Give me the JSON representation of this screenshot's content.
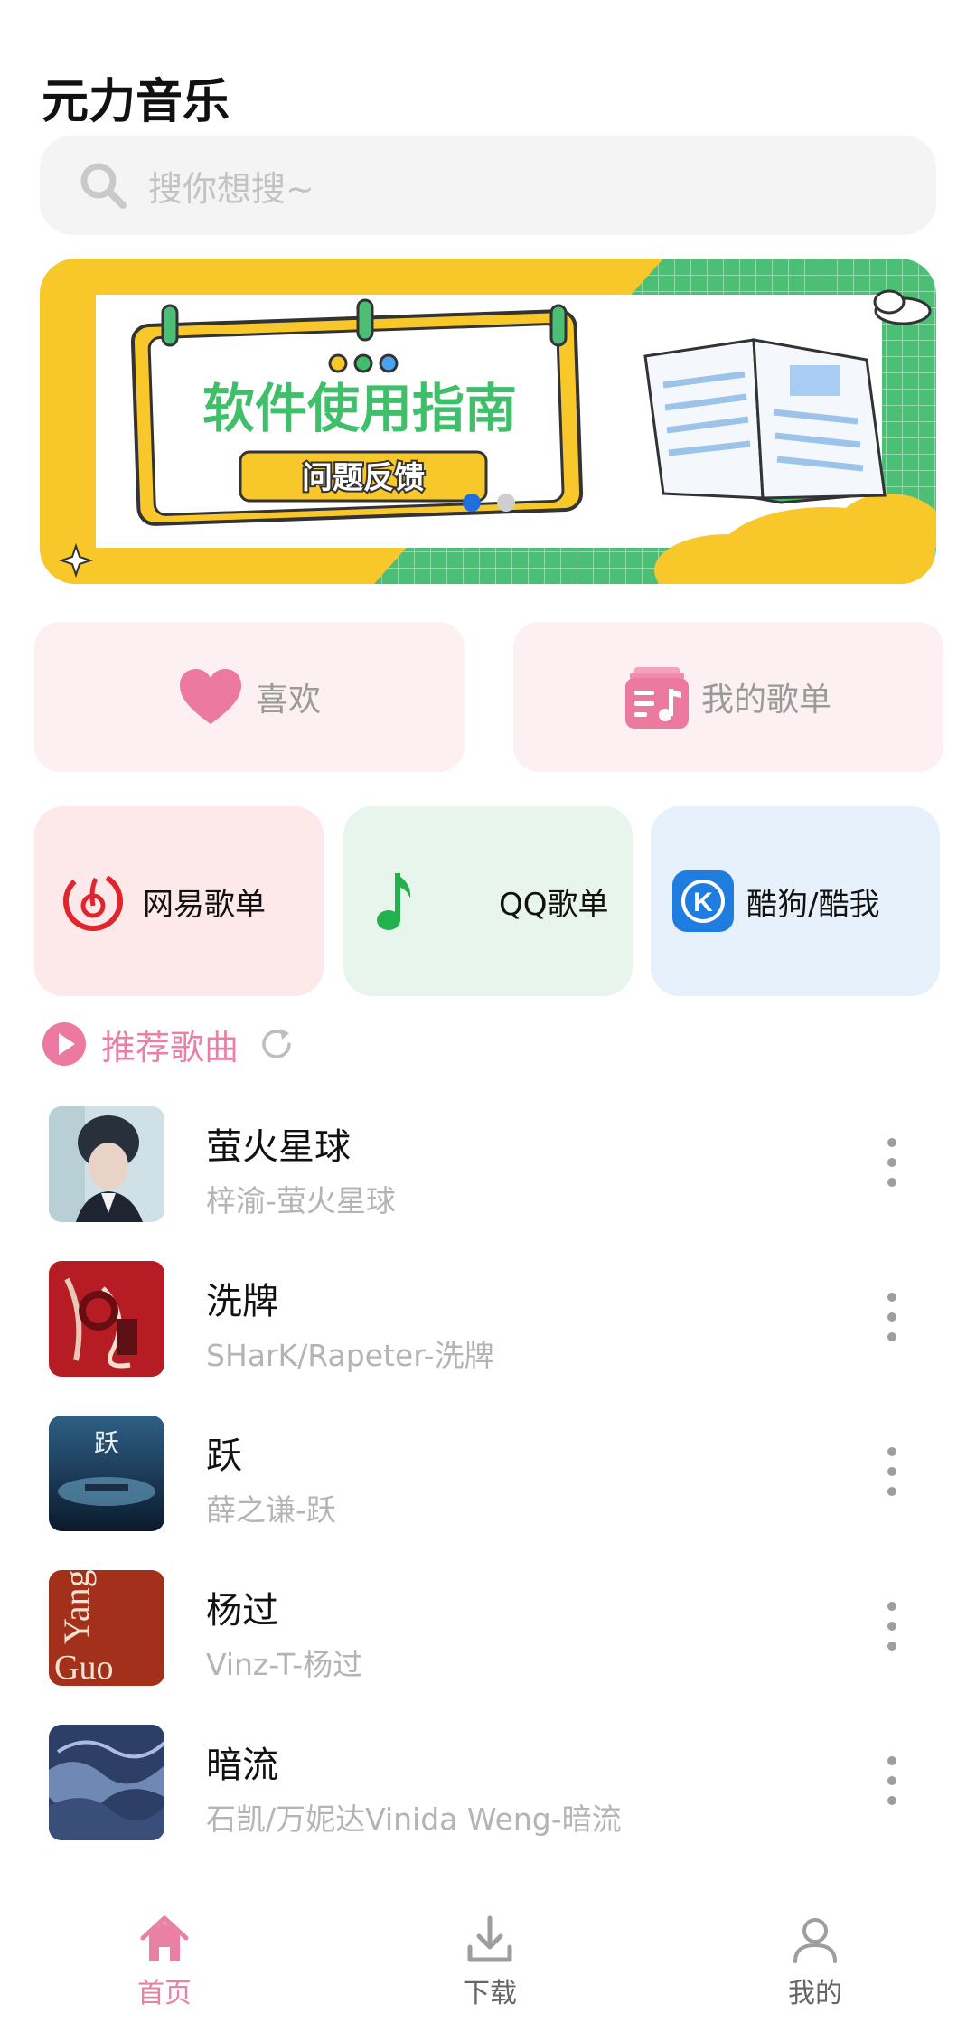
{
  "app": {
    "title": "元力音乐"
  },
  "search": {
    "placeholder": "搜你想搜~",
    "icon": "search-icon"
  },
  "banner": {
    "title": "软件使用指南",
    "button_label": "问题反馈",
    "page_indicator": {
      "total": 2,
      "active": 1
    }
  },
  "favorites": [
    {
      "label": "喜欢",
      "icon": "heart-icon",
      "color": "#ec7aa0"
    },
    {
      "label": "我的歌单",
      "icon": "playlist-icon",
      "color": "#ec7aa0"
    }
  ],
  "sources": [
    {
      "label": "网易歌单",
      "icon": "netease-icon",
      "color": "#e0262c"
    },
    {
      "label": "QQ歌单",
      "icon": "qq-music-icon",
      "color": "#22b14c"
    },
    {
      "label": "酷狗/酷我",
      "icon": "kugou-icon",
      "color": "#1f7de0"
    }
  ],
  "recommend": {
    "title": "推荐歌曲",
    "icon": "play-circle-icon",
    "refresh_icon": "refresh-icon"
  },
  "songs": [
    {
      "title": "萤火星球",
      "subtitle": "梓渝-萤火星球"
    },
    {
      "title": "洗牌",
      "subtitle": "SHarK/Rapeter-洗牌"
    },
    {
      "title": "跃",
      "subtitle": "薛之谦-跃"
    },
    {
      "title": "杨过",
      "subtitle": "Vinz-T-杨过"
    },
    {
      "title": "暗流",
      "subtitle": "石凯/万妮达Vinida Weng-暗流"
    }
  ],
  "cover_art": {
    "yangguo_text_1": "Yang",
    "yangguo_text_2": "Guo",
    "yue_text": "跃"
  },
  "tabbar": [
    {
      "label": "首页",
      "icon": "home-icon",
      "active": true
    },
    {
      "label": "下载",
      "icon": "download-icon",
      "active": false
    },
    {
      "label": "我的",
      "icon": "user-icon",
      "active": false
    }
  ],
  "colors": {
    "accent": "#e881a3",
    "banner_green": "#3fbf6a",
    "banner_yellow": "#f8c82a"
  }
}
